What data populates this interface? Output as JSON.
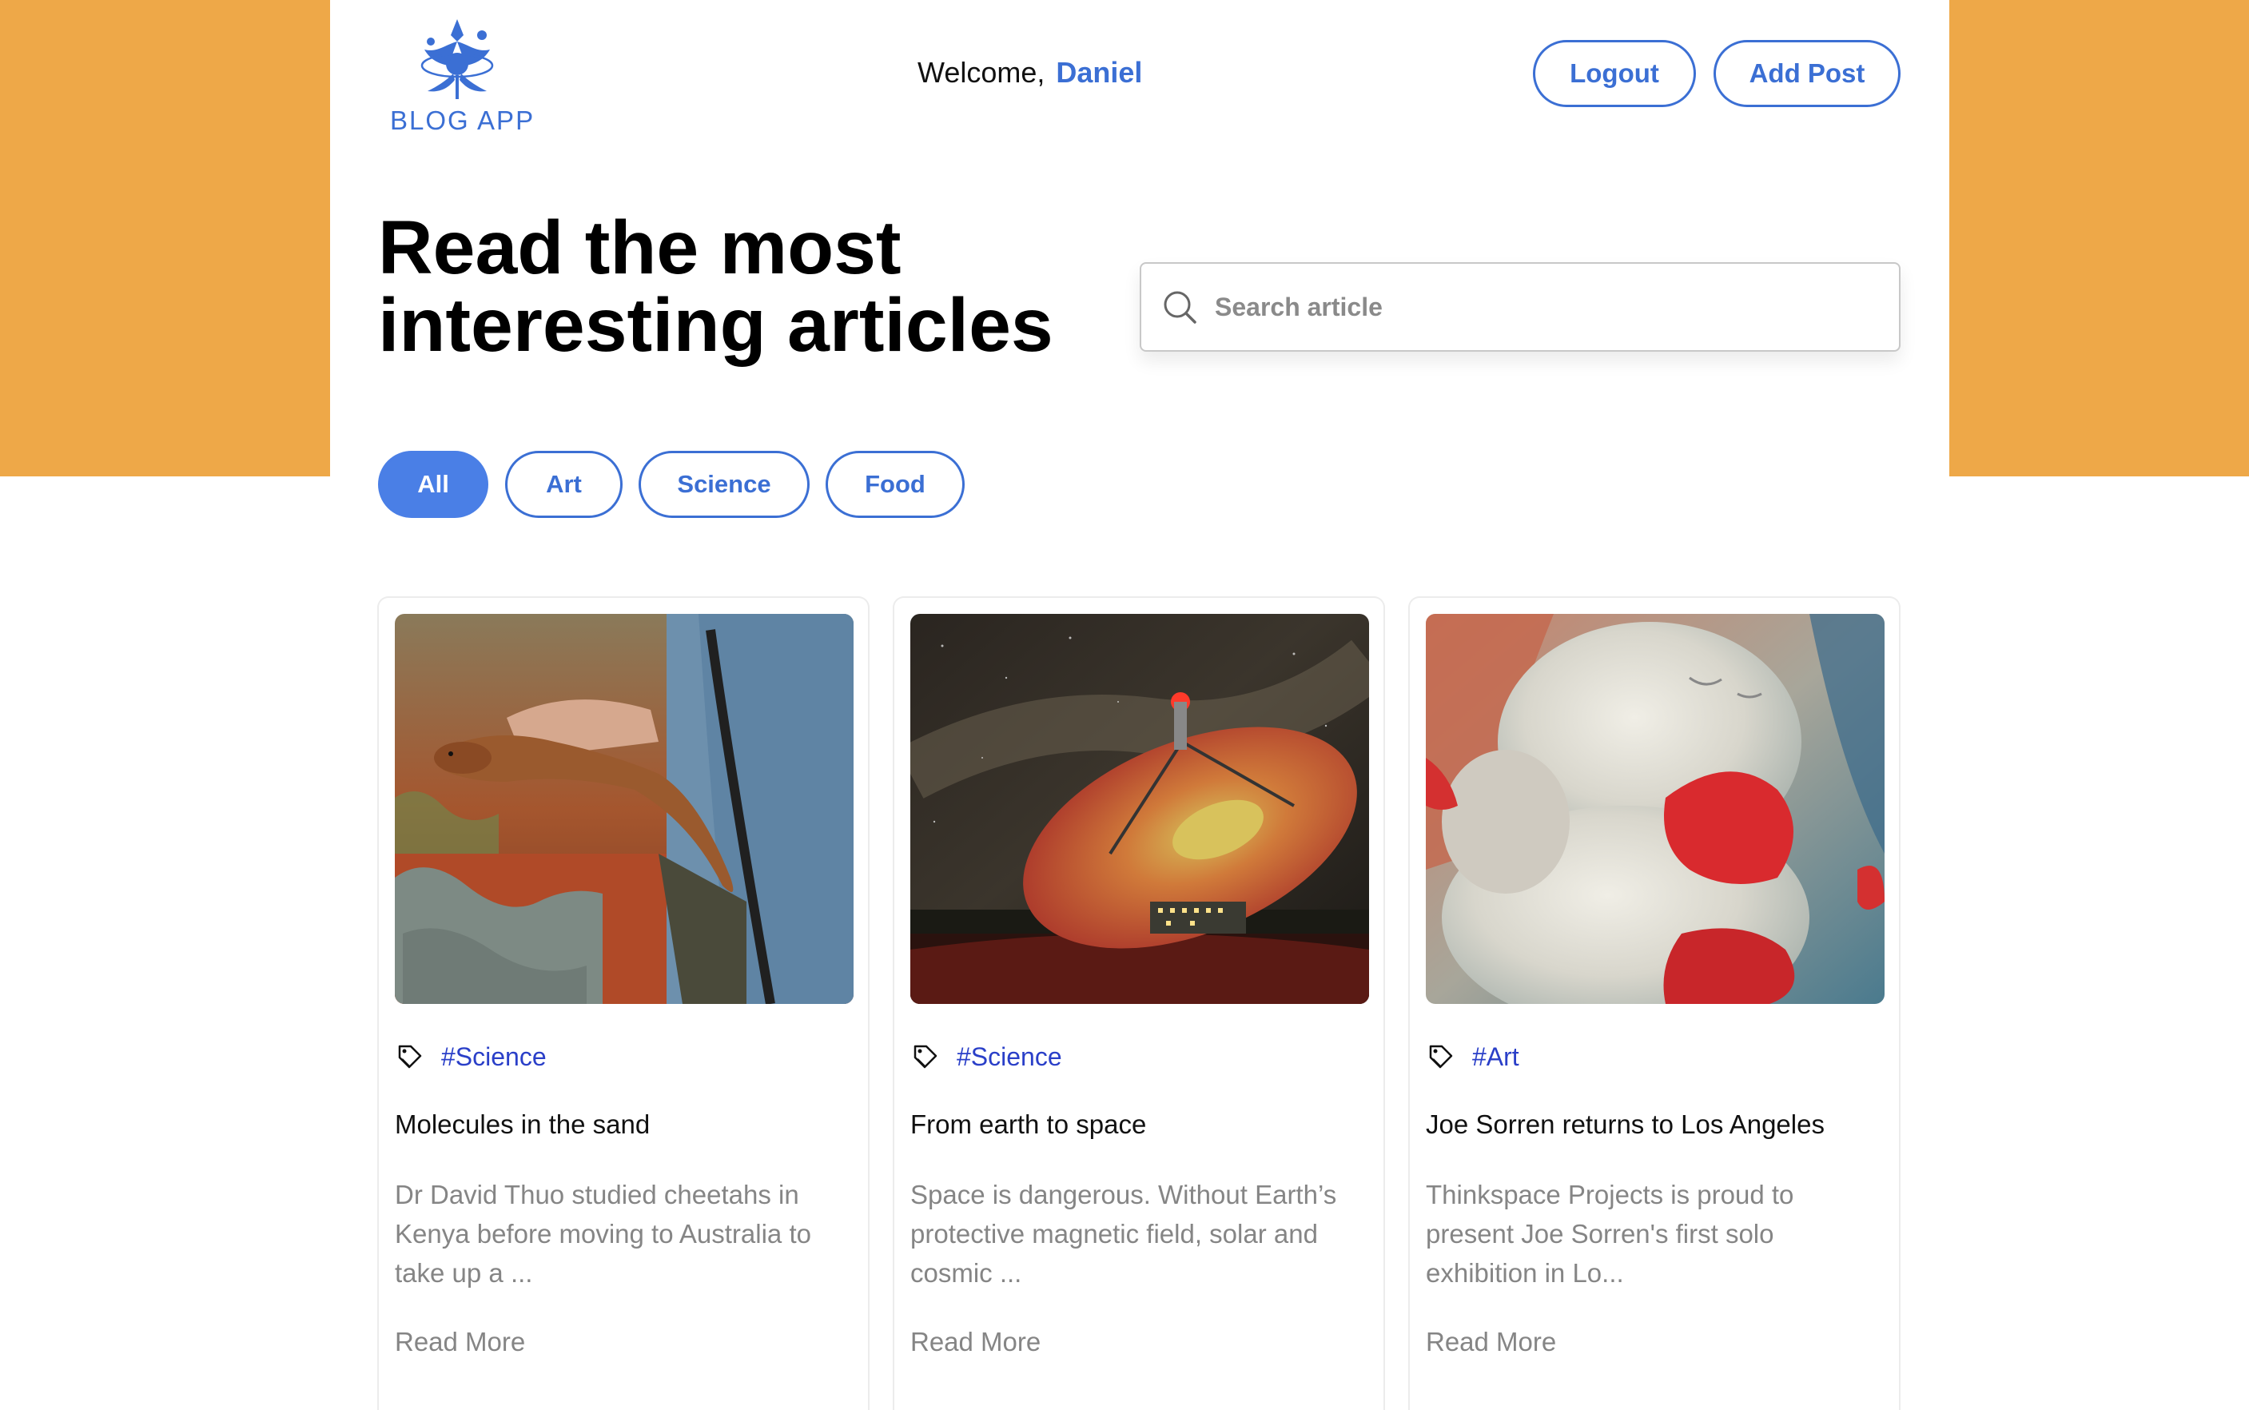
{
  "header": {
    "logo_text": "BLOG APP",
    "welcome_label": "Welcome,",
    "user_name": "Daniel",
    "logout_label": "Logout",
    "add_post_label": "Add Post"
  },
  "hero": {
    "headline_line1": "Read the most",
    "headline_line2": "interesting articles",
    "search_placeholder": "Search article"
  },
  "filters": [
    {
      "label": "All",
      "active": true
    },
    {
      "label": "Art",
      "active": false
    },
    {
      "label": "Science",
      "active": false
    },
    {
      "label": "Food",
      "active": false
    }
  ],
  "articles": [
    {
      "tag": "#Science",
      "title": "Molecules in the sand",
      "excerpt": "Dr David Thuo studied cheetahs in Kenya before moving to Australia to take up a ...",
      "read_more": "Read More",
      "image": "lizard-in-hand-photo"
    },
    {
      "tag": "#Science",
      "title": "From earth to space",
      "excerpt": "Space is dangerous. Without Earth’s protective magnetic field, solar and cosmic ...",
      "read_more": "Read More",
      "image": "radio-telescope-night-photo"
    },
    {
      "tag": "#Art",
      "title": "Joe Sorren returns to Los Angeles",
      "excerpt": "Thinkspace Projects is proud to present Joe Sorren's first solo exhibition in Lo...",
      "read_more": "Read More",
      "image": "bear-painting-artwork"
    }
  ],
  "icons": {
    "logo": "blog-app-logo-icon",
    "search": "search-icon",
    "tag": "tag-icon"
  },
  "colors": {
    "accent": "#3b6fd4",
    "background_band": "#eea848",
    "tag_text": "#2a3fc8",
    "muted_text": "#858585"
  }
}
